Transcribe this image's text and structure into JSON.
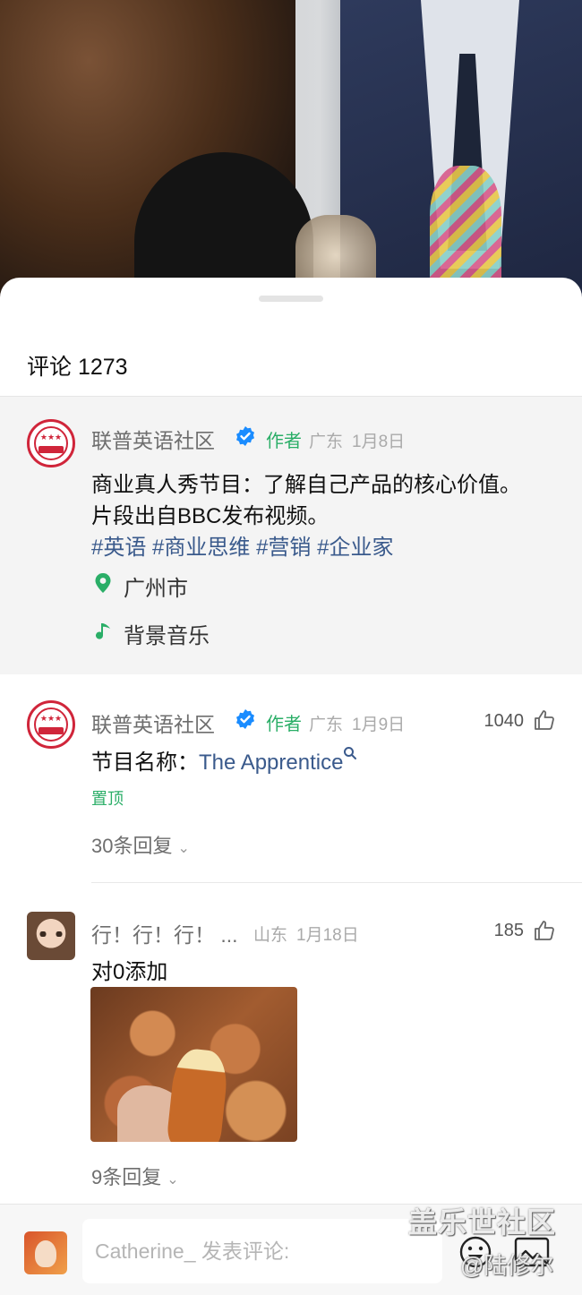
{
  "sheet": {
    "title": "评论 1273"
  },
  "post": {
    "author": "联普英语社区",
    "author_tag": "作者",
    "location": "广东",
    "date": "1月8日",
    "line1": "商业真人秀节目：了解自己产品的核心价值。",
    "line2": "片段出自BBC发布视频。",
    "hashtags": [
      "#英语",
      "#商业思维",
      "#营销",
      "#企业家"
    ],
    "place": "广州市",
    "music": "背景音乐"
  },
  "comments": [
    {
      "author": "联普英语社区",
      "author_tag": "作者",
      "location": "广东",
      "date": "1月9日",
      "likes": "1040",
      "text_prefix": "节目名称：",
      "text_link": "The Apprentice",
      "pinned": "置顶",
      "replies": "30条回复"
    },
    {
      "author": "行！行！行！ ...",
      "location": "山东",
      "date": "1月18日",
      "likes": "185",
      "text": "对0添加",
      "replies": "9条回复"
    }
  ],
  "input": {
    "placeholder": "Catherine_ 发表评论:"
  },
  "watermark": {
    "line1": "盖乐世社区",
    "line2": "@陆修尔"
  },
  "colors": {
    "accent_green": "#2aae67",
    "link_blue": "#3a5a8c",
    "verified_blue": "#1a8cff"
  }
}
